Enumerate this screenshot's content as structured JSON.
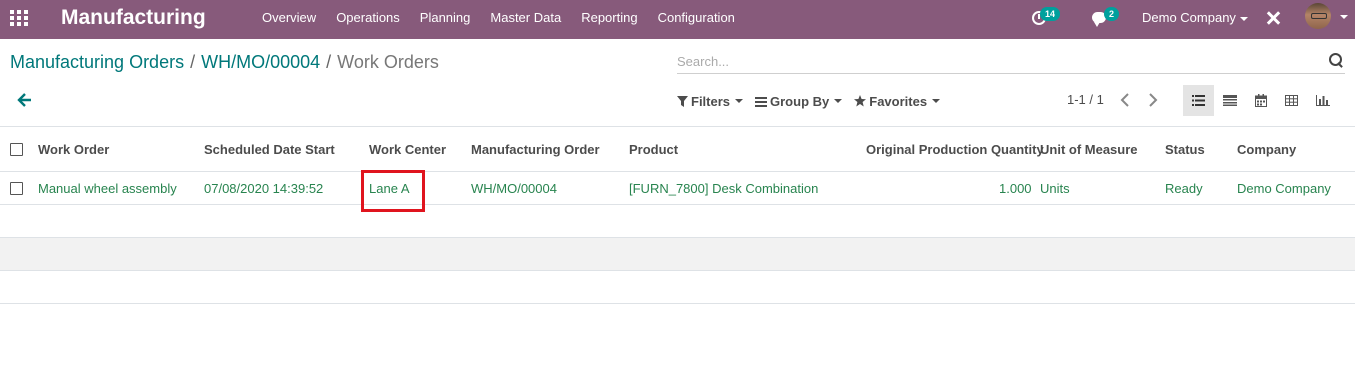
{
  "navbar": {
    "app_title": "Manufacturing",
    "menu": [
      "Overview",
      "Operations",
      "Planning",
      "Master Data",
      "Reporting",
      "Configuration"
    ],
    "activity_count": "14",
    "message_count": "2",
    "company": "Demo Company",
    "color": "#875a7b"
  },
  "breadcrumb": {
    "root": "Manufacturing Orders",
    "separator": "/",
    "order": "WH/MO/00004",
    "current": "Work Orders"
  },
  "search": {
    "placeholder": "Search...",
    "value": ""
  },
  "filters": {
    "filters_label": "Filters",
    "group_by_label": "Group By",
    "favorites_label": "Favorites"
  },
  "pager": {
    "value": "1-1 / 1"
  },
  "views": [
    "list",
    "gantt",
    "calendar",
    "pivot",
    "graph"
  ],
  "table": {
    "columns": [
      "Work Order",
      "Scheduled Date Start",
      "Work Center",
      "Manufacturing Order",
      "Product",
      "Original Production Quantity",
      "Unit of Measure",
      "Status",
      "Company"
    ],
    "rows": [
      {
        "work_order": "Manual wheel assembly",
        "scheduled_date_start": "07/08/2020 14:39:52",
        "work_center": "Lane A",
        "manufacturing_order": "WH/MO/00004",
        "product": "[FURN_7800] Desk Combination",
        "original_production_quantity": "1.000",
        "unit_of_measure": "Units",
        "status": "Ready",
        "company": "Demo Company"
      }
    ]
  },
  "colors": {
    "accent": "#00a09d",
    "link": "#00787a",
    "row_text": "#28844f",
    "highlight": "#e0141e"
  }
}
